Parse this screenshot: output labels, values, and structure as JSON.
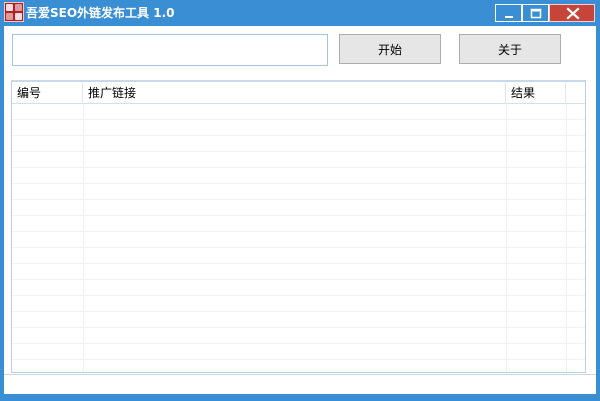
{
  "window": {
    "title": "吾爱SEO外链发布工具 1.0",
    "accent_color": "#3a8ed4",
    "close_color": "#c7443a",
    "icons": {
      "app": "app-logo-icon",
      "minimize": "minimize-icon",
      "maximize": "maximize-icon",
      "close": "close-icon"
    }
  },
  "toolbar": {
    "url_input_value": "",
    "start_label": "开始",
    "about_label": "关于"
  },
  "table": {
    "columns": [
      "编号",
      "推广链接",
      "结果"
    ],
    "rows": []
  }
}
